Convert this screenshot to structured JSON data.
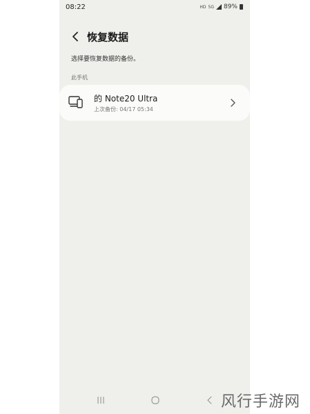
{
  "status_bar": {
    "time": "08:22",
    "network_label": "5G",
    "battery_percent": "89%"
  },
  "header": {
    "title": "恢复数据"
  },
  "description": "选择要恢复数据的备份。",
  "section_label": "此手机",
  "backup_item": {
    "name": "的 Note20 Ultra",
    "last_backup": "上次备份: 04/17 05:34"
  },
  "watermark": "风行手游网",
  "icons": {
    "back": "chevron-left-icon",
    "device": "phone-and-tablet-icon",
    "item_arrow": "chevron-right-icon",
    "nav_recents": "recents-icon",
    "nav_home": "home-icon",
    "nav_back": "back-icon"
  },
  "colors": {
    "screen_background": "#efefec",
    "card_background": "#fbfbfa",
    "primary_text": "#1b1b1b",
    "secondary_text": "#777777"
  }
}
